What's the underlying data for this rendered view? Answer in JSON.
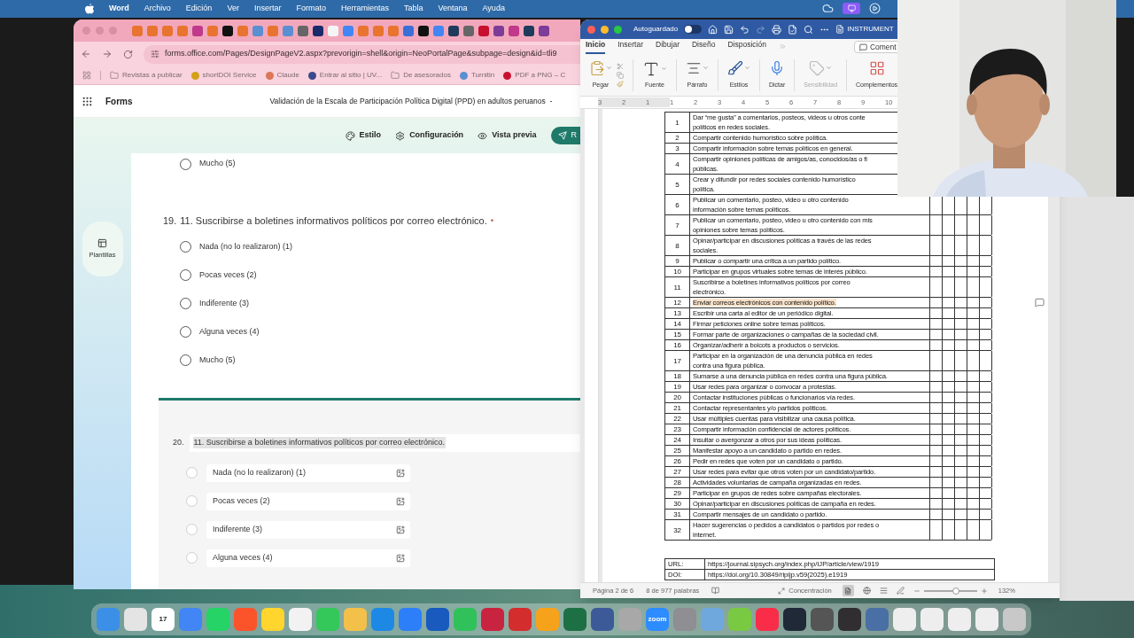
{
  "menu_bar": {
    "app": "Word",
    "items": [
      "Archivo",
      "Edición",
      "Ver",
      "Insertar",
      "Formato",
      "Herramientas",
      "Tabla",
      "Ventana",
      "Ayuda"
    ]
  },
  "browser": {
    "tabs": [
      {
        "color": "#e8742f"
      },
      {
        "color": "#e8742f"
      },
      {
        "color": "#e8742f"
      },
      {
        "color": "#e8742f"
      },
      {
        "color": "#c0398a"
      },
      {
        "color": "#e8742f"
      },
      {
        "color": "#111111"
      },
      {
        "color": "#e8742f"
      },
      {
        "color": "#5b8fd1"
      },
      {
        "color": "#e8742f"
      },
      {
        "color": "#5b8fd1"
      },
      {
        "color": "#666666"
      },
      {
        "color": "#1b2a6b"
      },
      {
        "color": "#f5f5f5"
      },
      {
        "color": "#4285f4"
      },
      {
        "color": "#e8742f"
      },
      {
        "color": "#e8742f"
      },
      {
        "color": "#e8742f"
      },
      {
        "color": "#3a6fd8"
      },
      {
        "color": "#111111"
      },
      {
        "color": "#4285f4"
      },
      {
        "color": "#1f3b5c"
      },
      {
        "color": "#666666"
      },
      {
        "color": "#c8102e"
      },
      {
        "color": "#7d3c98"
      },
      {
        "color": "#c0398a"
      },
      {
        "color": "#1f3b5c"
      },
      {
        "color": "#7d3c98"
      }
    ],
    "address": "forms.office.com/Pages/DesignPageV2.aspx?prevorigin=shell&origin=NeoPortalPage&subpage=design&id=tli9",
    "bookmarks": [
      {
        "kind": "folder",
        "label": "Revistas a publicar"
      },
      {
        "kind": "site",
        "color": "#d4a017",
        "label": "shortDOI Service"
      },
      {
        "kind": "site",
        "color": "#d97757",
        "label": "Claude"
      },
      {
        "kind": "site",
        "color": "#3b4a8c",
        "label": "Entrar al sitio | UV..."
      },
      {
        "kind": "folder",
        "label": "De asesorados"
      },
      {
        "kind": "site",
        "color": "#5b8fd1",
        "label": "Turnitin"
      },
      {
        "kind": "site",
        "color": "#c8102e",
        "label": "PDF a PNG – C"
      }
    ],
    "forms": {
      "app_name": "Forms",
      "form_title": "Validación de la Escala de Participación Política Digital (PPD) en adultos peruanos  -",
      "toolbar": [
        {
          "kind": "style",
          "label": "Estilo"
        },
        {
          "kind": "settings",
          "label": "Configuración"
        },
        {
          "kind": "preview",
          "label": "Vista previa"
        }
      ],
      "send_button": "R",
      "side_button": "Plantillas",
      "previous_option": {
        "label": "Mucho (5)",
        "selected": false
      },
      "question": {
        "number": "19.",
        "title": "11. Suscribirse a boletines informativos políticos por correo electrónico.",
        "required_mark": "*",
        "options": [
          {
            "label": "Nada (no lo realizaron) (1)",
            "selected": false
          },
          {
            "label": "Pocas veces (2)",
            "selected": false
          },
          {
            "label": "Indiferente (3)",
            "selected": false
          },
          {
            "label": "Alguna veces (4)",
            "selected": false
          },
          {
            "label": "Mucho (5)",
            "selected": false
          }
        ]
      },
      "edit_question": {
        "number": "20.",
        "title": "11. Suscribirse a boletines informativos políticos por correo electrónico.",
        "options": [
          {
            "label": "Nada (no lo realizaron) (1)",
            "selected": false
          },
          {
            "label": "Pocas veces (2)",
            "selected": false
          },
          {
            "label": "Indiferente (3)",
            "selected": false
          },
          {
            "label": "Alguna veces (4)",
            "selected": false
          }
        ]
      }
    }
  },
  "word": {
    "title": "INSTRUMENT",
    "autosave": {
      "label": "Autoguardado",
      "on": false
    },
    "tabs": [
      {
        "label": "Inicio",
        "selected": true
      },
      {
        "label": "Insertar",
        "selected": false
      },
      {
        "label": "Dibujar",
        "selected": false
      },
      {
        "label": "Diseño",
        "selected": false
      },
      {
        "label": "Disposición",
        "selected": false
      }
    ],
    "comments_button": "Coment",
    "ribbon": [
      {
        "kind": "paste",
        "label": "Pegar",
        "disabled": false
      },
      {
        "kind": "font",
        "label": "Fuente",
        "disabled": false
      },
      {
        "kind": "paragraph",
        "label": "Párrafo",
        "disabled": false
      },
      {
        "kind": "styles",
        "label": "Estilos",
        "disabled": false
      },
      {
        "kind": "dictate",
        "label": "Dictar",
        "disabled": false
      },
      {
        "kind": "sensitivity",
        "label": "Sensibilidad",
        "disabled": true
      },
      {
        "kind": "addins",
        "label": "Complementos",
        "disabled": false
      }
    ],
    "ruler_marks": [
      "3",
      "2",
      "1",
      "1",
      "2",
      "3",
      "4",
      "5",
      "6",
      "7",
      "8",
      "9",
      "10"
    ],
    "table": {
      "rows": [
        {
          "number": "1",
          "lines": [
            "Dar “me gusta” a comentarios, posteos, videos u otros conte",
            "políticos en redes sociales."
          ],
          "highlighted": false
        },
        {
          "number": "2",
          "lines": [
            "Compartir contenido humorístico sobre política."
          ],
          "highlighted": false
        },
        {
          "number": "3",
          "lines": [
            "Compartir información sobre temas políticos en general."
          ],
          "highlighted": false
        },
        {
          "number": "4",
          "lines": [
            "Compartir opiniones políticas de amigos/as, conocidos/as o fi",
            "públicas."
          ],
          "highlighted": false
        },
        {
          "number": "5",
          "lines": [
            "Crear y difundir por redes sociales contenido humorístico",
            "política."
          ],
          "highlighted": false
        },
        {
          "number": "6",
          "lines": [
            "Publicar un comentario, posteo, video u otro contenido",
            "información sobre temas políticos."
          ],
          "highlighted": false
        },
        {
          "number": "7",
          "lines": [
            "Publicar un comentario, posteo, video u otro contenido con mis",
            "opiniones sobre temas políticos."
          ],
          "highlighted": false
        },
        {
          "number": "8",
          "lines": [
            "Opinar/participar en discusiones políticas a través de las redes",
            "sociales."
          ],
          "highlighted": false
        },
        {
          "number": "9",
          "lines": [
            "Publicar o compartir una crítica a un partido político."
          ],
          "highlighted": false
        },
        {
          "number": "10",
          "lines": [
            "Participar en grupos virtuales sobre temas de interés público."
          ],
          "highlighted": false
        },
        {
          "number": "11",
          "lines": [
            "Suscribirse a boletines informativos políticos por correo",
            "electrónico."
          ],
          "highlighted": false
        },
        {
          "number": "12",
          "lines": [
            "Enviar correos electrónicos con contenido político."
          ],
          "highlighted": true
        },
        {
          "number": "13",
          "lines": [
            "Escribir una carta al editor de un periódico digital."
          ],
          "highlighted": false
        },
        {
          "number": "14",
          "lines": [
            "Firmar peticiones online sobre temas políticos."
          ],
          "highlighted": false
        },
        {
          "number": "15",
          "lines": [
            "Formar parte de organizaciones o campañas de la sociedad civil."
          ],
          "highlighted": false
        },
        {
          "number": "16",
          "lines": [
            "Organizar/adherir a boicots a productos o servicios."
          ],
          "highlighted": false
        },
        {
          "number": "17",
          "lines": [
            "Participar en la organización de una denuncia pública en redes",
            "contra una figura pública."
          ],
          "highlighted": false
        },
        {
          "number": "18",
          "lines": [
            "Sumarse a una denuncia pública en redes contra una figura pública."
          ],
          "highlighted": false
        },
        {
          "number": "19",
          "lines": [
            "Usar redes para organizar o convocar a protestas."
          ],
          "highlighted": false
        },
        {
          "number": "20",
          "lines": [
            "Contactar instituciones públicas o funcionarios vía redes."
          ],
          "highlighted": false
        },
        {
          "number": "21",
          "lines": [
            "Contactar representantes y/o partidos políticos."
          ],
          "highlighted": false
        },
        {
          "number": "22",
          "lines": [
            "Usar múltiples cuentas para visibilizar una causa política."
          ],
          "highlighted": false
        },
        {
          "number": "23",
          "lines": [
            "Compartir información confidencial de actores políticos."
          ],
          "highlighted": false
        },
        {
          "number": "24",
          "lines": [
            "Insultar o avergonzar a otros por sus ideas políticas."
          ],
          "highlighted": false
        },
        {
          "number": "25",
          "lines": [
            "Manifestar apoyo a un candidato o partido en redes."
          ],
          "highlighted": false
        },
        {
          "number": "26",
          "lines": [
            "Pedir en redes que voten por un candidato o partido."
          ],
          "highlighted": false
        },
        {
          "number": "27",
          "lines": [
            "Usar redes para evitar que otros voten por un candidato/partido."
          ],
          "highlighted": false
        },
        {
          "number": "28",
          "lines": [
            "Actividades voluntarias de campaña organizadas en redes."
          ],
          "highlighted": false
        },
        {
          "number": "29",
          "lines": [
            "Participar en grupos de redes sobre campañas electorales."
          ],
          "highlighted": false
        },
        {
          "number": "30",
          "lines": [
            "Opinar/participar en discusiones políticas de campaña en redes."
          ],
          "highlighted": false
        },
        {
          "number": "31",
          "lines": [
            "Compartir mensajes de un candidato o partido."
          ],
          "highlighted": false
        },
        {
          "number": "32",
          "lines": [
            "Hacer sugerencias o pedidos a candidatos o partidos por redes o",
            "internet."
          ],
          "highlighted": false
        }
      ]
    },
    "links": [
      {
        "label": "URL:",
        "value": "https://journal.sipsych.org/index.php/IJP/article/view/1919"
      },
      {
        "label": "DOI:",
        "value": "https://doi.org/10.30849/ripijp.v59(2025).e1919"
      }
    ],
    "status": {
      "page": "Página 2 de 6",
      "words": "8 de 977 palabras",
      "focus": "Concentración",
      "zoom": {
        "level": 0.6
      },
      "zoom_label": "132%"
    }
  },
  "dock": [
    {
      "color": "#3b8fe6"
    },
    {
      "color": "#e4e4e4"
    },
    {
      "color": "#ffffff",
      "text": "17"
    },
    {
      "color": "#4285f4"
    },
    {
      "color": "#25d366"
    },
    {
      "color": "#fb542b"
    },
    {
      "color": "#ffd52e"
    },
    {
      "color": "#f2f2f2"
    },
    {
      "color": "#34c759"
    },
    {
      "color": "#f3c04a"
    },
    {
      "color": "#1e88e5"
    },
    {
      "color": "#2d7ff9"
    },
    {
      "color": "#185abd"
    },
    {
      "color": "#31c15b"
    },
    {
      "color": "#c9243f"
    },
    {
      "color": "#d42d2d"
    },
    {
      "color": "#f7a21b"
    },
    {
      "color": "#1d7044"
    },
    {
      "color": "#3d5a98"
    },
    {
      "color": "#a8a8a8"
    },
    {
      "color": "#2d8cff",
      "text": "zoom"
    },
    {
      "color": "#8e8e93"
    },
    {
      "color": "#6fa8dc"
    },
    {
      "color": "#7ac943"
    },
    {
      "color": "#fa2d48"
    },
    {
      "color": "#1f2937"
    },
    {
      "color": "#555555"
    },
    {
      "color": "#302e31"
    },
    {
      "color": "#4a6fa5"
    },
    {
      "color": "#eeeeee"
    },
    {
      "color": "#eeeeee"
    },
    {
      "color": "#eeeeee"
    },
    {
      "color": "#eeeeee"
    },
    {
      "color": "#c8c8c8"
    }
  ]
}
